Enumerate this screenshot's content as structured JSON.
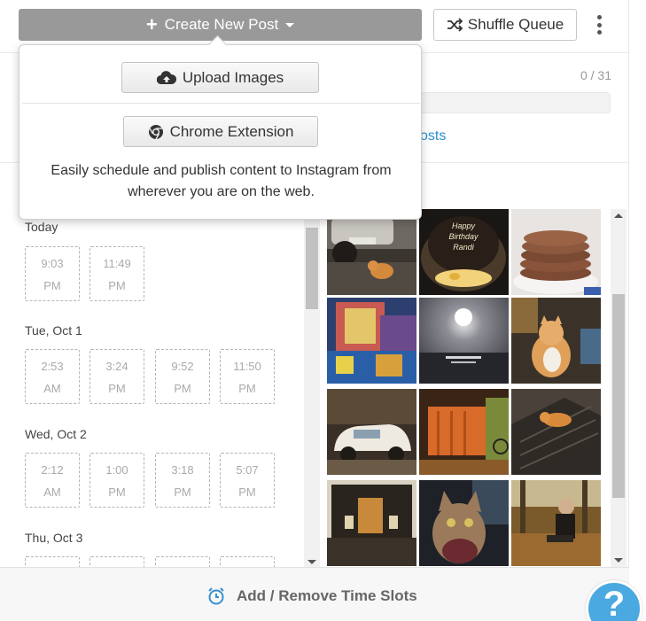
{
  "toolbar": {
    "create_label": "Create New Post",
    "shuffle_label": "Shuffle Queue"
  },
  "stats": {
    "count": "0 / 31",
    "link_fragment": "osts"
  },
  "dropdown": {
    "upload_label": "Upload Images",
    "chrome_label": "Chrome Extension",
    "description": "Easily schedule and publish content to Instagram from wherever you are on the web."
  },
  "schedule": {
    "days": [
      {
        "label": "Today",
        "slots": [
          {
            "time": "9:03",
            "period": "PM"
          },
          {
            "time": "11:49",
            "period": "PM"
          }
        ]
      },
      {
        "label": "Tue, Oct 1",
        "slots": [
          {
            "time": "2:53",
            "period": "AM"
          },
          {
            "time": "3:24",
            "period": "PM"
          },
          {
            "time": "9:52",
            "period": "PM"
          },
          {
            "time": "11:50",
            "period": "PM"
          }
        ]
      },
      {
        "label": "Wed, Oct 2",
        "slots": [
          {
            "time": "2:12",
            "period": "AM"
          },
          {
            "time": "1:00",
            "period": "PM"
          },
          {
            "time": "3:18",
            "period": "PM"
          },
          {
            "time": "5:07",
            "period": "PM"
          }
        ]
      },
      {
        "label": "Thu, Oct 3",
        "slots": [
          {
            "time": "",
            "period": ""
          },
          {
            "time": "",
            "period": ""
          },
          {
            "time": "",
            "period": ""
          },
          {
            "time": "",
            "period": ""
          }
        ]
      }
    ]
  },
  "gallery": {
    "photos": [
      "photo-car-and-cat",
      "photo-birthday-cake",
      "photo-pancakes",
      "photo-colorful-market",
      "photo-moon-over-sea",
      "photo-cat-in-cafe",
      "photo-vintage-white-car",
      "photo-orange-fence",
      "photo-cat-on-roof",
      "photo-shop-window",
      "photo-cat-selfie",
      "photo-woman-autumn"
    ],
    "cake_text": "Happy Birthday Randi"
  },
  "footer": {
    "time_slots_label": "Add / Remove Time Slots",
    "help_glyph": "?"
  },
  "colors": {
    "create_button": "#999999",
    "link": "#2a8fd0",
    "help_bubble": "#4aa9e0"
  }
}
